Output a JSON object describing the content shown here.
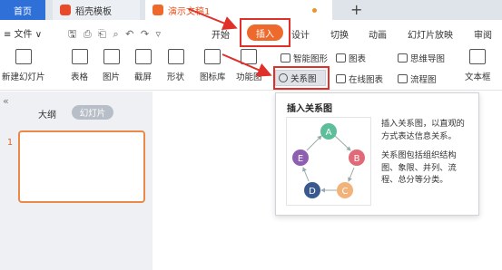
{
  "tabs": {
    "home": "首页",
    "daoke": "稻壳模板",
    "doc": "演示文稿1",
    "new_tab": "+"
  },
  "menu": {
    "file": "≡ 文件 ∨",
    "items": [
      "开始",
      "插入",
      "设计",
      "切换",
      "动画",
      "幻灯片放映",
      "审阅"
    ]
  },
  "ribbon": {
    "new_slide": "新建幻灯片",
    "table": "表格",
    "picture": "图片",
    "screenshot": "截屏",
    "shape": "形状",
    "icon_lib": "图标库",
    "function_chart": "功能图",
    "smart_art": "智能图形",
    "chart": "图表",
    "mind_map": "思维导图",
    "text_box": "文本框",
    "relation": "关系图",
    "online_chart": "在线图表",
    "flowchart": "流程图"
  },
  "panel": {
    "outline": "大纲",
    "slides": "幻灯片",
    "slide_number": "1",
    "collapse": "«"
  },
  "tooltip": {
    "title": "插入关系图",
    "desc1": "插入关系图，以直观的方式表达信息关系。",
    "desc2": "关系图包括组织结构图、象限、并列、流程、总分等分类。",
    "nodes": [
      "A",
      "B",
      "C",
      "D",
      "E"
    ]
  },
  "colors": {
    "accent": "#ee6a2c",
    "highlight": "#e0302a",
    "node_a": "#5dbf9a",
    "node_b": "#e06a78",
    "node_c": "#f2b37a",
    "node_d": "#3a5a8f",
    "node_e": "#8e5fb0"
  }
}
